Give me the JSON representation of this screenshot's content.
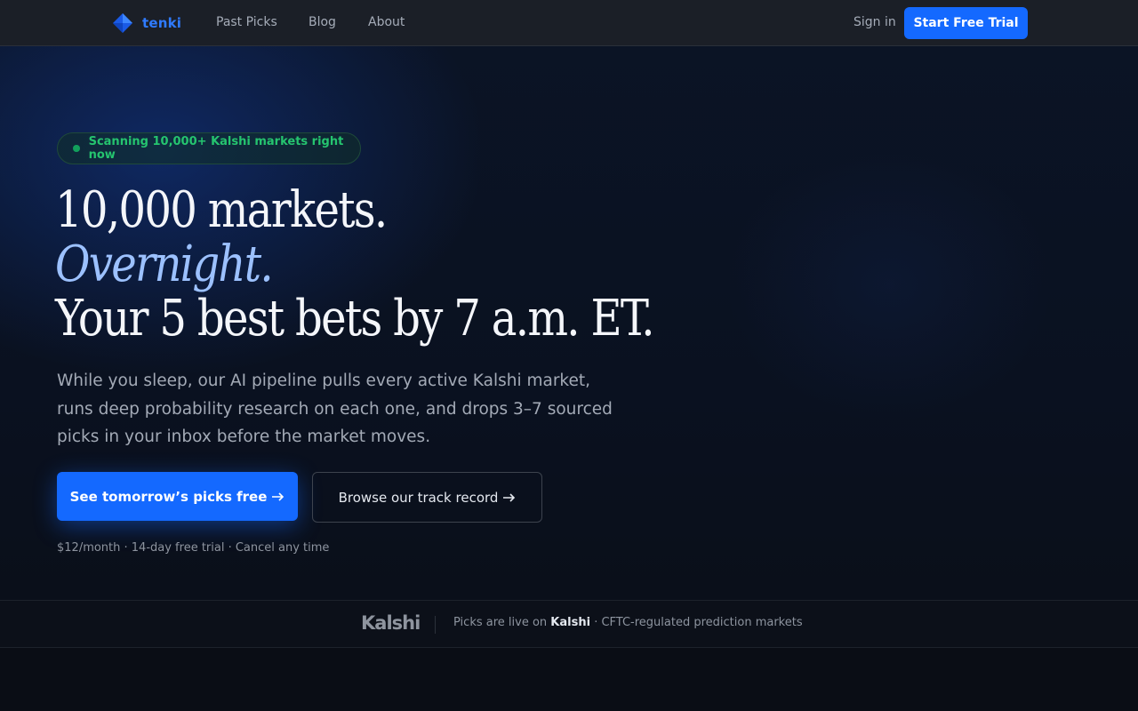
{
  "nav": {
    "brand": "tenki",
    "links": [
      "Past Picks",
      "Blog",
      "About"
    ],
    "sign_in": "Sign in",
    "cta": "Start Free Trial"
  },
  "hero": {
    "badge": "Scanning 10,000+ Kalshi markets right now",
    "headline_line1": "10,000 markets.",
    "headline_line2": "Overnight.",
    "headline_line3": "Your 5 best bets by 7 a.m. ET.",
    "subtext": "While you sleep, our AI pipeline pulls every active Kalshi market, runs deep probability research on each one, and drops 3–7 sourced picks in your inbox before the market moves.",
    "primary_cta": "See tomorrow’s picks free",
    "secondary_cta": "Browse our track record",
    "fine_print": "$12/month · 14-day free trial · Cancel any time"
  },
  "strip": {
    "logo": "Kalshi",
    "text_prefix": "Picks are live on",
    "text_brand": "Kalshi",
    "text_suffix": "· CFTC-regulated prediction markets"
  },
  "colors": {
    "accent": "#1469ff",
    "badge_green": "#25c46f",
    "headline_italic": "#9cc1ff",
    "background": "#0a0e16"
  },
  "icons": {
    "logo": "diamond-logo-icon",
    "arrow": "arrow-right-icon",
    "status": "status-dot-icon"
  }
}
